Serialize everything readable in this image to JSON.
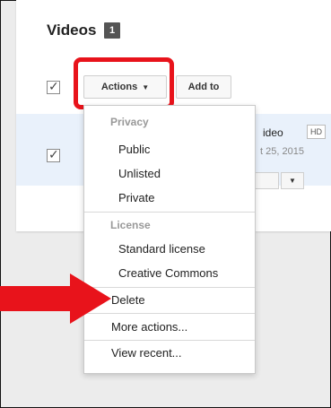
{
  "section": {
    "title": "Videos",
    "count": "1"
  },
  "toolbar": {
    "actions_label": "Actions",
    "add_to_label": "Add to"
  },
  "video": {
    "title_partial": "ideo",
    "quality_badge": "HD",
    "date_partial": "t 25, 2015"
  },
  "actions_menu": {
    "privacy_header": "Privacy",
    "public": "Public",
    "unlisted": "Unlisted",
    "private": "Private",
    "license_header": "License",
    "standard_license": "Standard license",
    "creative_commons": "Creative Commons",
    "delete": "Delete",
    "more_actions": "More actions...",
    "view_recent": "View recent..."
  },
  "annotation": {
    "arrow_color": "#e8131b",
    "highlight_color": "#e8131b"
  }
}
